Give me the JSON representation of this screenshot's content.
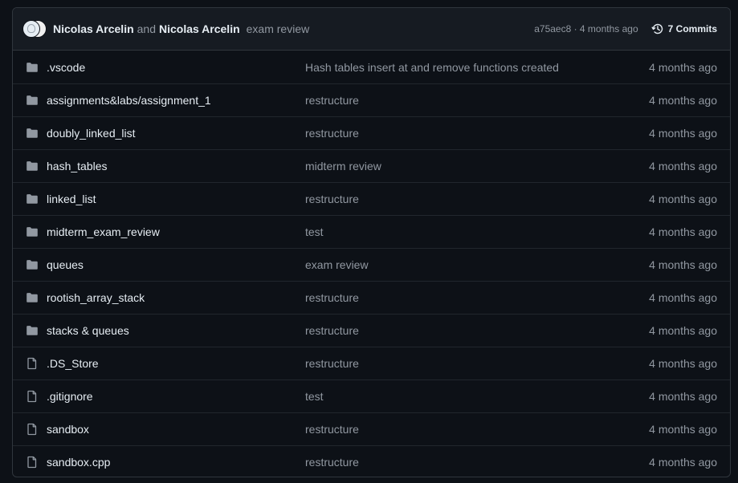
{
  "header": {
    "author1": "Nicolas Arcelin",
    "and": "and",
    "author2": "Nicolas Arcelin",
    "message": "exam review",
    "sha_and_time": "a75aec8 · 4 months ago",
    "commits_label": "7 Commits"
  },
  "files": [
    {
      "type": "folder",
      "name": ".vscode",
      "message": "Hash tables insert at and remove functions created",
      "date": "4 months ago"
    },
    {
      "type": "folder",
      "name": "assignments&labs/assignment_1",
      "message": "restructure",
      "date": "4 months ago"
    },
    {
      "type": "folder",
      "name": "doubly_linked_list",
      "message": "restructure",
      "date": "4 months ago"
    },
    {
      "type": "folder",
      "name": "hash_tables",
      "message": "midterm review",
      "date": "4 months ago"
    },
    {
      "type": "folder",
      "name": "linked_list",
      "message": "restructure",
      "date": "4 months ago"
    },
    {
      "type": "folder",
      "name": "midterm_exam_review",
      "message": "test",
      "date": "4 months ago"
    },
    {
      "type": "folder",
      "name": "queues",
      "message": "exam review",
      "date": "4 months ago"
    },
    {
      "type": "folder",
      "name": "rootish_array_stack",
      "message": "restructure",
      "date": "4 months ago"
    },
    {
      "type": "folder",
      "name": "stacks & queues",
      "message": "restructure",
      "date": "4 months ago"
    },
    {
      "type": "file",
      "name": ".DS_Store",
      "message": "restructure",
      "date": "4 months ago"
    },
    {
      "type": "file",
      "name": ".gitignore",
      "message": "test",
      "date": "4 months ago"
    },
    {
      "type": "file",
      "name": "sandbox",
      "message": "restructure",
      "date": "4 months ago"
    },
    {
      "type": "file",
      "name": "sandbox.cpp",
      "message": "restructure",
      "date": "4 months ago"
    }
  ],
  "icons": {
    "folder": "folder-icon",
    "file": "file-icon",
    "history": "history-icon"
  },
  "colors": {
    "background": "#0d1117",
    "header_bg": "#161b22",
    "border": "#30363d",
    "text": "#e6edf3",
    "muted": "#9198a1"
  }
}
